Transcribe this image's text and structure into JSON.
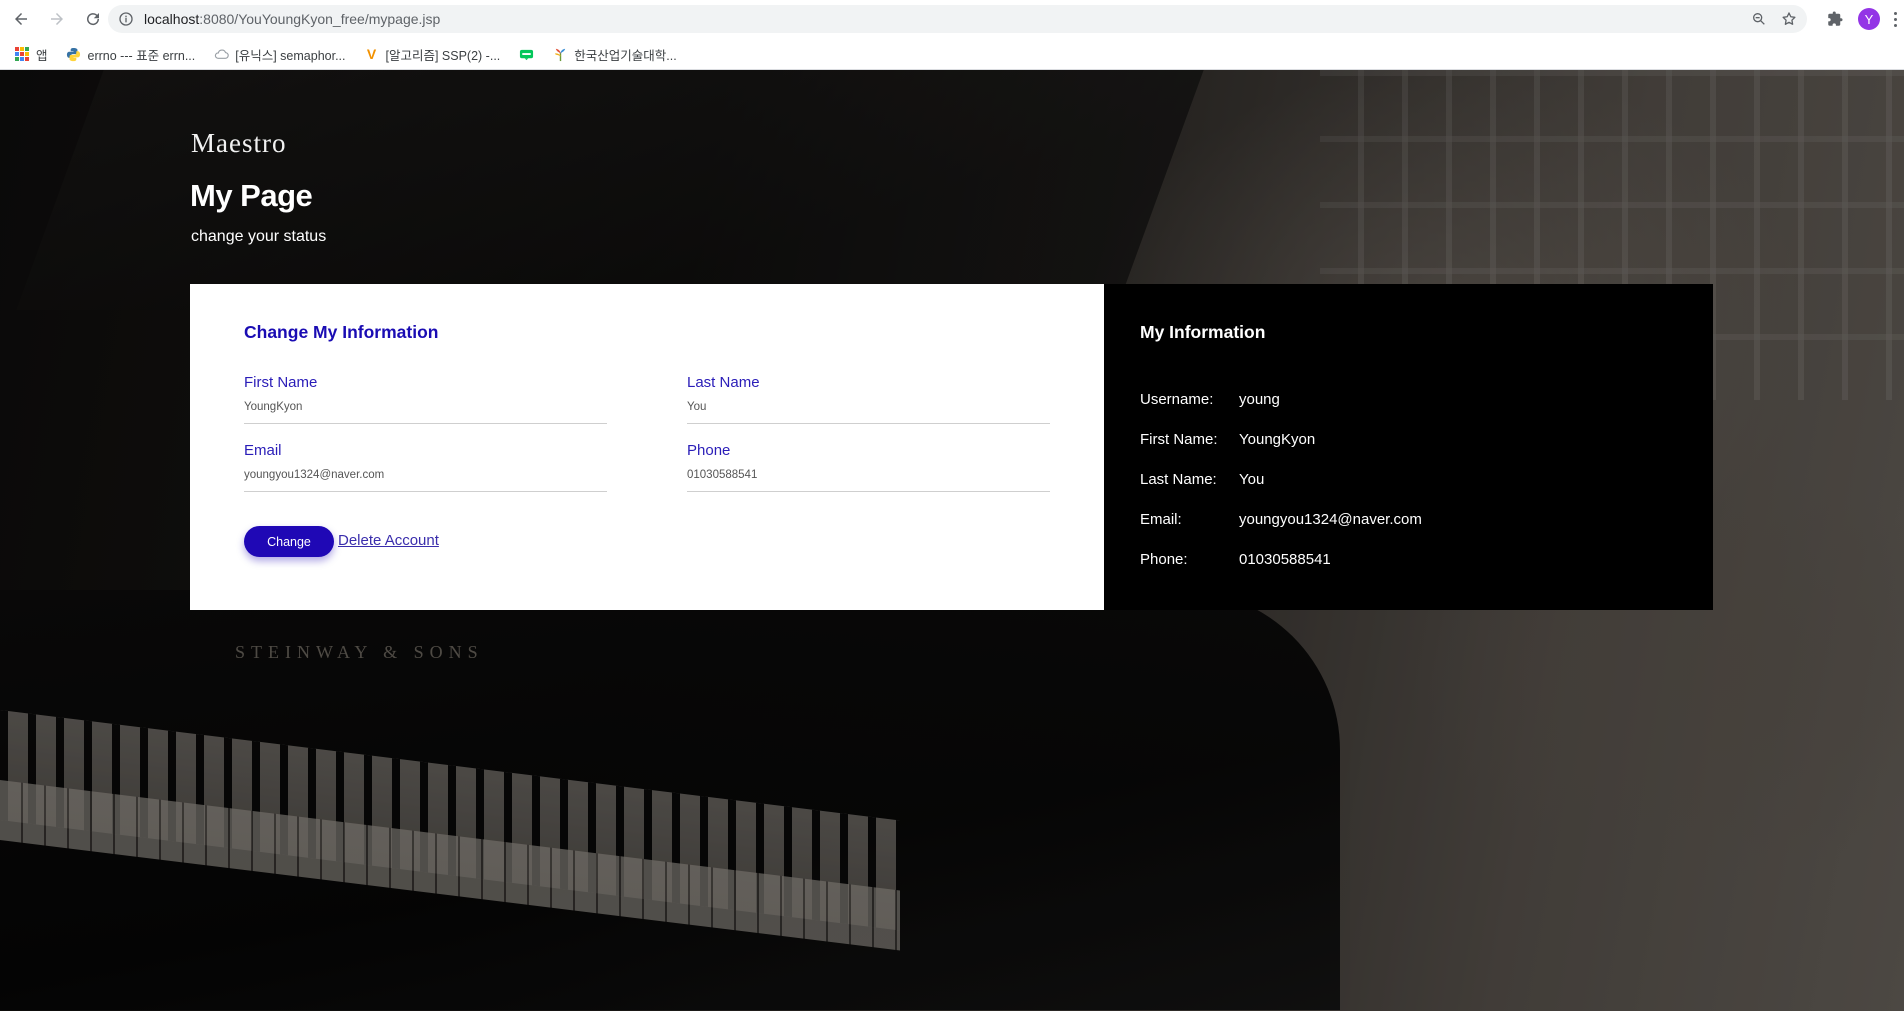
{
  "browser": {
    "url_host": "localhost",
    "url_path": ":8080/YouYoungKyon_free/mypage.jsp",
    "avatar_letter": "Y",
    "bookmarks": [
      {
        "label": "앱",
        "icon": "apps-icon"
      },
      {
        "label": "errno --- 표준 errn...",
        "icon": "python-icon"
      },
      {
        "label": "[유닉스] semaphor...",
        "icon": "cloud-icon"
      },
      {
        "label": "[알고리즘] SSP(2) -...",
        "icon": "v-icon"
      },
      {
        "label": "",
        "icon": "blog-icon"
      },
      {
        "label": "한국산업기술대학...",
        "icon": "university-icon"
      }
    ]
  },
  "site": {
    "logo": "Maestro",
    "title": "My Page",
    "subtitle": "change your status",
    "background_brand": "STEINWAY & SONS"
  },
  "form": {
    "title": "Change My Information",
    "fields": [
      {
        "label": "First Name",
        "value": "YoungKyon"
      },
      {
        "label": "Last Name",
        "value": "You"
      },
      {
        "label": "Email",
        "value": "youngyou1324@naver.com"
      },
      {
        "label": "Phone",
        "value": "01030588541"
      }
    ],
    "change_label": "Change",
    "delete_label": "Delete Account"
  },
  "info": {
    "title": "My Information",
    "rows": [
      {
        "key": "Username:",
        "value": "young"
      },
      {
        "key": "First Name:",
        "value": "YoungKyon"
      },
      {
        "key": "Last Name:",
        "value": "You"
      },
      {
        "key": "Email:",
        "value": "youngyou1324@naver.com"
      },
      {
        "key": "Phone:",
        "value": "01030588541"
      }
    ]
  },
  "colors": {
    "accent": "#1f08b5",
    "label": "#2a1db8",
    "info_bg": "#000000"
  }
}
